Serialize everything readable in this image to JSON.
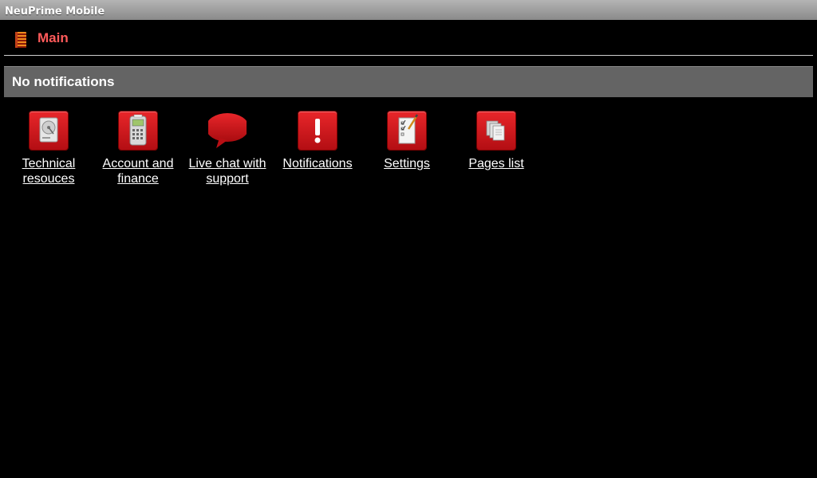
{
  "window": {
    "title": "NeuPrime Mobile"
  },
  "header": {
    "title": "Main"
  },
  "notifications_bar": {
    "text": "No notifications"
  },
  "tiles": [
    {
      "label": "Technical resouces",
      "icon": "hard-drive-icon"
    },
    {
      "label": "Account and finance",
      "icon": "card-terminal-icon"
    },
    {
      "label": "Live chat with support",
      "icon": "speech-bubble-icon"
    },
    {
      "label": "Notifications",
      "icon": "exclamation-icon"
    },
    {
      "label": "Settings",
      "icon": "checklist-icon"
    },
    {
      "label": "Pages list",
      "icon": "pages-icon"
    }
  ],
  "colors": {
    "accent": "#ff5a5a",
    "tile_red": "#d11a1f",
    "bar_gray": "#646464"
  }
}
